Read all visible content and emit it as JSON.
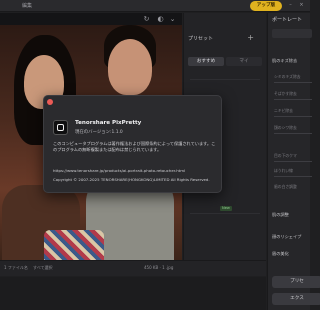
{
  "topbar": {
    "menu_1": "",
    "menu_2": "編集",
    "upgrade_label": "アップ版",
    "minimize": "–",
    "close": "×"
  },
  "presets": {
    "title": "プリセット",
    "add": "+",
    "tab_recommended": "おすすめ",
    "tab_mine": "マイ",
    "badge": "New"
  },
  "right_panel": {
    "title": "ポートレート",
    "section_1": "肌のキズ除去",
    "labels": [
      "シミのキズ除去",
      "そばかす除去",
      "ニキビ除去",
      "顔のシワ除去",
      "目の下のクマ",
      "ほうれい線",
      "歯の白さ調整"
    ],
    "section_2": "肌の調整",
    "section_3": "顔のリシェイプ",
    "section_4": "眉の美化",
    "button_1": "プリセ",
    "button_2": "エクス"
  },
  "bottombar": {
    "file_count": "1 ファイル名",
    "select_all": "すべて選択",
    "size_info": "450 KB · 1 .jpg"
  },
  "dialog": {
    "app_name": "Tenorshare PixPretty",
    "version": "現在のバージョン:1.1.0",
    "legal": "このコンピュータプログラムは著作権法および国際条約によって保護されています。このプログラムの無断複製または配布は禁じられています。",
    "url": "https://www.tenorshare.jp/products/ai-portrait-photo-retoucher.html",
    "copyright": "Copyright © 2007-2025 TENORSHARE(HONGKONG)LIMITED All Rights Reserved."
  }
}
